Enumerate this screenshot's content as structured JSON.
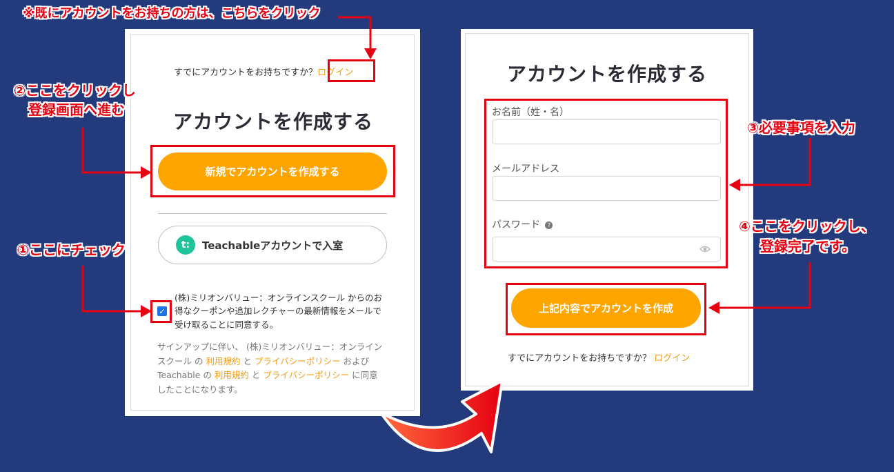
{
  "annotations": {
    "top_note": "※既にアカウントをお持ちの方は、こちらをクリック",
    "step2_line1": "②ここをクリックし",
    "step2_line2": "登録画面へ進む",
    "step1": "①ここにチェック",
    "step3": "③必要事項を入力",
    "step4_line1": "④ここをクリックし、",
    "step4_line2": "登録完了です。"
  },
  "left_card": {
    "already_text": "すでにアカウントをお持ちですか？",
    "login_link": "ログイン",
    "title": "アカウントを作成する",
    "new_account_button": "新規でアカウントを作成する",
    "teachable_logo": "t:",
    "teachable_button": "Teachableアカウントで入室",
    "consent_text": "(株)ミリオンバリュー：オンラインスクール からのお得なクーポンや追加レクチャーの最新情報をメールで受け取ることに同意する。",
    "checkbox_checked": true,
    "terms": {
      "p1": "サインアップに伴い、 (株)ミリオンバリュー：オンラインスクール の ",
      "link1": "利用規約",
      "p2": " と ",
      "link2": "プライバシーポリシー",
      "p3": " および Teachable の ",
      "link3": "利用規約",
      "p4": " と ",
      "link4": "プライバシーポリシー",
      "p5": " に同意したことになります。"
    }
  },
  "right_card": {
    "title": "アカウントを作成する",
    "name_label": "お名前（姓・名）",
    "email_label": "メールアドレス",
    "password_label": "パスワード",
    "help_icon": "?",
    "submit_button": "上記内容でアカウントを作成",
    "already_text": "すでにアカウントをお持ちですか？",
    "login_link": "ログイン"
  },
  "colors": {
    "background": "#233b7c",
    "accent_orange": "#ffa500",
    "annotation_red": "#e60012",
    "teachable_green": "#1fc49a"
  },
  "icons": [
    "eye-icon",
    "help-icon",
    "checkbox-check-icon",
    "curved-arrow-icon"
  ]
}
